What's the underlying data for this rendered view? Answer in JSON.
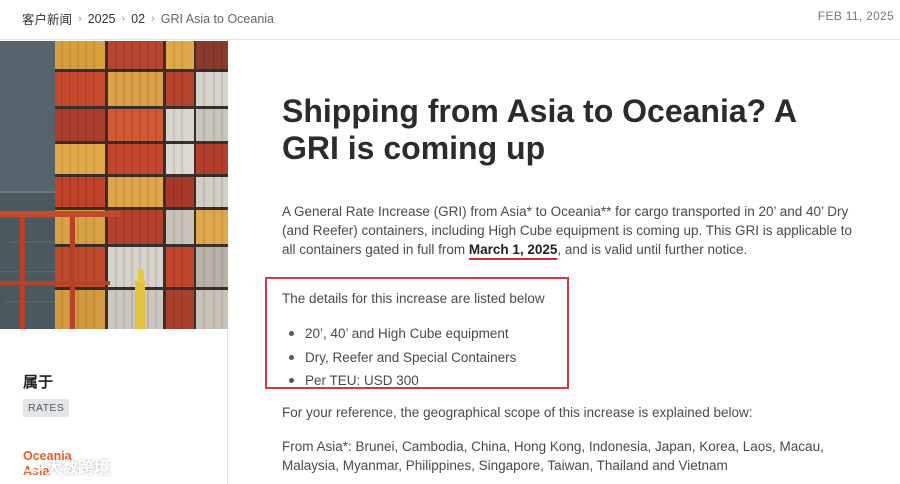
{
  "breadcrumb": {
    "items": [
      "客户新闻",
      "2025",
      "02"
    ],
    "current": "GRI Asia to Oceania"
  },
  "date": "FEB 11, 2025",
  "sidebar": {
    "belongs_label": "属于",
    "tag": "RATES",
    "route_line1": "Oceania",
    "route_line2": "Asia"
  },
  "watermark": {
    "text": "大数跨境"
  },
  "article": {
    "title": "Shipping from Asia to Oceania? A GRI is coming up",
    "intro_before": "A General Rate Increase (GRI) from Asia* to Oceania** for cargo transported in 20’ and 40’ Dry (and Reefer) containers, including High Cube equipment is coming up. This GRI is applicable to all containers gated in full from ",
    "intro_date": "March 1, 2025",
    "intro_after": ", and is valid until further notice.",
    "details_intro": "The details for this increase are listed below",
    "bullets": [
      "20’, 40’ and High Cube equipment",
      "Dry, Reefer and Special Containers",
      "Per TEU: USD 300"
    ],
    "reference": "For your reference, the geographical scope of this increase is explained below:",
    "scope_label": "From Asia*",
    "scope_list": ": Brunei, Cambodia, China, Hong Kong, Indonesia, Japan, Korea, Laos, Macau, Malaysia, Myanmar, Philippines, Singapore, Taiwan, Thailand and Vietnam"
  },
  "colors": {
    "accent_orange": "#e8622b",
    "highlight_red": "#d9363e"
  }
}
